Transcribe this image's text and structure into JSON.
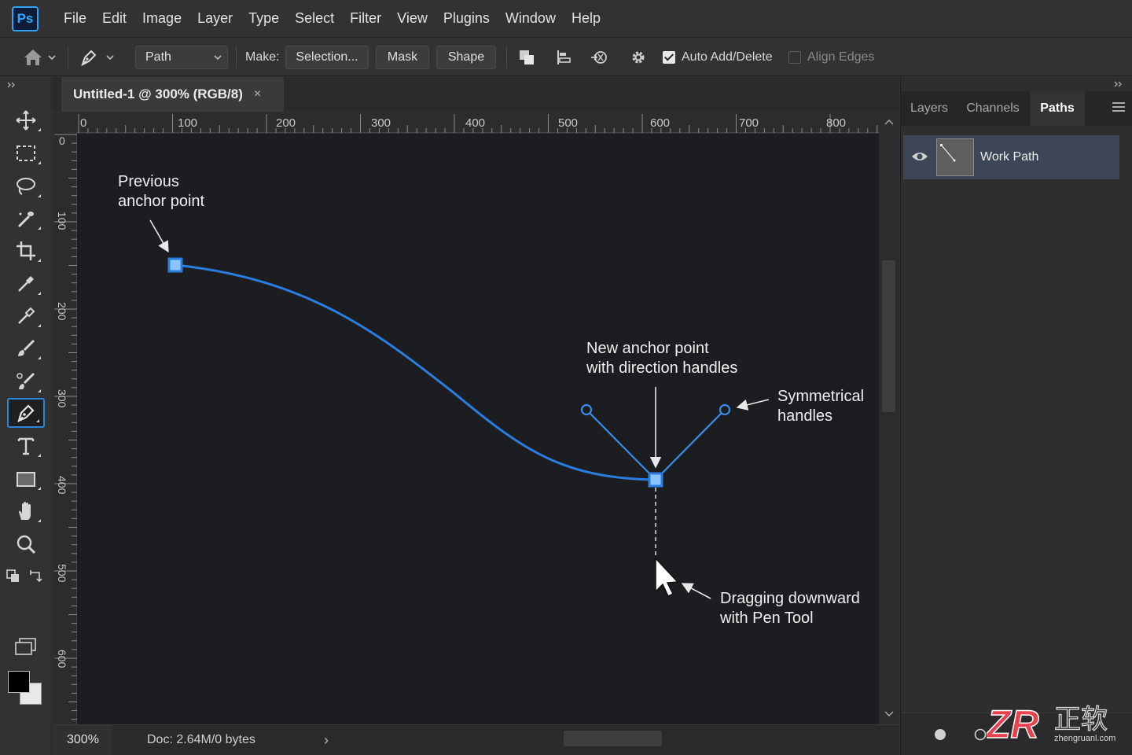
{
  "app": {
    "logo": "Ps"
  },
  "menu": [
    "File",
    "Edit",
    "Image",
    "Layer",
    "Type",
    "Select",
    "Filter",
    "View",
    "Plugins",
    "Window",
    "Help"
  ],
  "options": {
    "mode_value": "Path",
    "make_label": "Make:",
    "selection_btn": "Selection...",
    "mask_btn": "Mask",
    "shape_btn": "Shape",
    "auto_add_delete": "Auto Add/Delete",
    "auto_add_delete_checked": true,
    "align_edges": "Align Edges",
    "align_edges_checked": false
  },
  "document": {
    "tab_title": "Untitled-1 @ 300% (RGB/8)",
    "close_glyph": "×",
    "ruler_h": [
      "0",
      "100",
      "200",
      "300",
      "400",
      "500",
      "600",
      "700",
      "800"
    ],
    "ruler_v": [
      "0",
      "100",
      "200",
      "300",
      "400",
      "500",
      "600"
    ]
  },
  "annotations": {
    "previous_anchor": [
      "Previous",
      "anchor point"
    ],
    "new_anchor": [
      "New anchor point",
      "with direction handles"
    ],
    "symmetrical": [
      "Symmetrical",
      "handles"
    ],
    "dragging": [
      "Dragging downward",
      "with Pen Tool"
    ]
  },
  "status": {
    "zoom": "300%",
    "doc_info": "Doc: 2.64M/0 bytes",
    "arrow": "›"
  },
  "panels": {
    "tabs": [
      "Layers",
      "Channels",
      "Paths"
    ],
    "active_tab": "Paths",
    "path_name": "Work Path"
  },
  "colors": {
    "accent": "#2a85d8",
    "path_stroke": "#2a7de1",
    "anchor_fill": "#8cc4ff"
  },
  "watermark": {
    "logo": "ZR",
    "text": "正软",
    "url": "zhengruanl.com"
  }
}
